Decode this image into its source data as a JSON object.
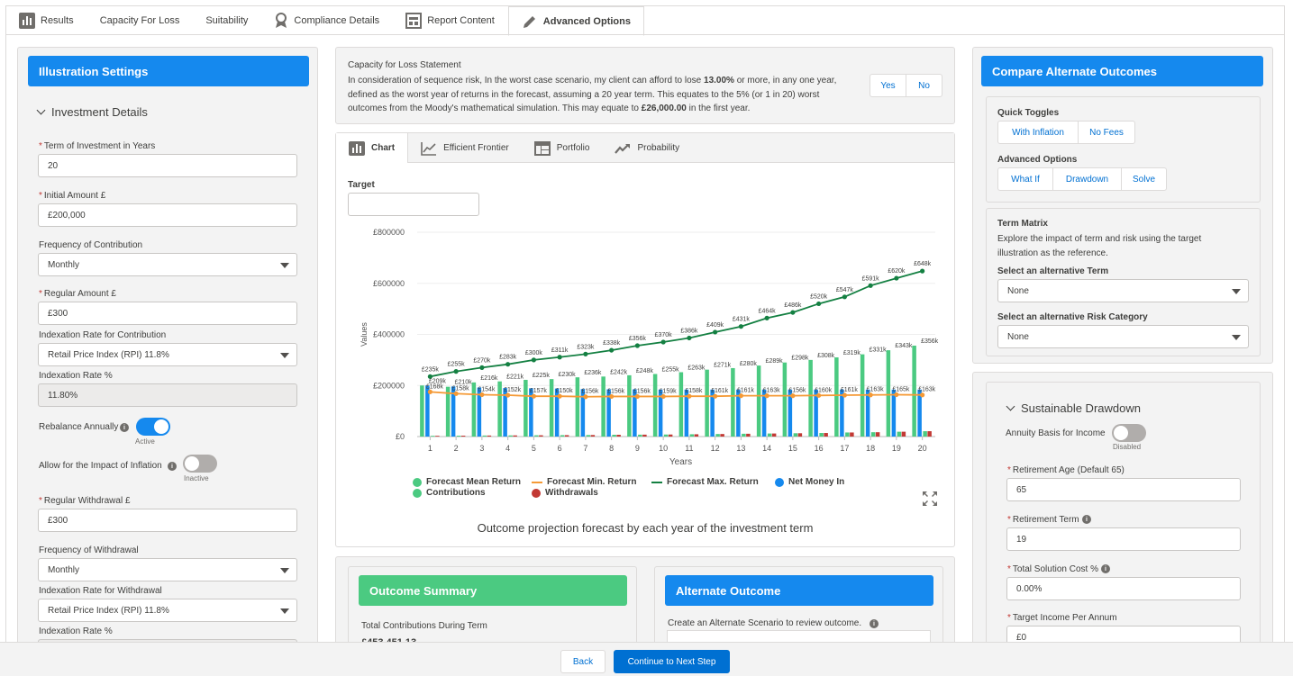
{
  "tabs": [
    {
      "label": "Results",
      "icon": "bar-chart-icon"
    },
    {
      "label": "Capacity For Loss",
      "icon": ""
    },
    {
      "label": "Suitability",
      "icon": ""
    },
    {
      "label": "Compliance Details",
      "icon": "award-icon"
    },
    {
      "label": "Report Content",
      "icon": "report-icon"
    },
    {
      "label": "Advanced Options",
      "icon": "pencil-icon"
    }
  ],
  "left": {
    "header": "Illustration Settings",
    "section": "Investment Details",
    "term_label": "Term of Investment in Years",
    "term_value": "20",
    "initial_label": "Initial Amount £",
    "initial_value": "£200,000",
    "freq_contrib_label": "Frequency of Contribution",
    "freq_contrib_value": "Monthly",
    "regular_label": "Regular Amount £",
    "regular_value": "£300",
    "index_contrib_label": "Indexation Rate for Contribution",
    "index_contrib_value": "Retail Price Index (RPI) 11.8%",
    "index_pct_label": "Indexation Rate %",
    "index_pct_value": "11.80%",
    "rebalance_label": "Rebalance Annually",
    "rebalance_state": "Active",
    "inflation_label": "Allow for the Impact of Inflation",
    "inflation_state": "Inactive",
    "withdraw_label": "Regular Withdrawal £",
    "withdraw_value": "£300",
    "freq_withdraw_label": "Frequency of Withdrawal",
    "freq_withdraw_value": "Monthly",
    "index_withdraw_label": "Indexation Rate for Withdrawal",
    "index_withdraw_value": "Retail Price Index (RPI) 11.8%",
    "index_pct2_label": "Indexation Rate %"
  },
  "cfl": {
    "title": "Capacity for Loss Statement",
    "text_1": "In consideration of sequence risk, In the worst case scenario, my client can afford to lose ",
    "pct": "13.00%",
    "text_2": " or more, in any one year, defined as the worst year of returns in the forecast, assuming a 20 year term. This equates to the 5% (or 1 in 20) worst outcomes from the Moody's mathematical simulation. This may equate to ",
    "amount": "£26,000.00",
    "text_3": " in the first year.",
    "yes": "Yes",
    "no": "No"
  },
  "chart_tabs": [
    {
      "label": "Chart",
      "icon": "bar-chart-icon"
    },
    {
      "label": "Efficient Frontier",
      "icon": "line-chart-icon"
    },
    {
      "label": "Portfolio",
      "icon": "table-icon"
    },
    {
      "label": "Probability",
      "icon": "trend-icon"
    }
  ],
  "target_label": "Target",
  "chart_caption": "Outcome projection forecast by each year of the investment term",
  "chart_data": {
    "type": "bar",
    "xlabel": "Years",
    "ylabel": "Values",
    "y_ticks": [
      "£0",
      "£200000",
      "£400000",
      "£600000",
      "£800000"
    ],
    "ylim": [
      0,
      800000
    ],
    "categories": [
      "1",
      "2",
      "3",
      "4",
      "5",
      "6",
      "7",
      "8",
      "9",
      "10",
      "11",
      "12",
      "13",
      "14",
      "15",
      "16",
      "17",
      "18",
      "19",
      "20"
    ],
    "legend_position": "bottom",
    "series": [
      {
        "name": "Forecast Mean Return",
        "kind": "bar",
        "color": "#4bca81",
        "values": [
          200000,
          195000,
          212000,
          216000,
          222000,
          225000,
          232000,
          235000,
          240000,
          245000,
          252000,
          262000,
          268000,
          278000,
          290000,
          300000,
          310000,
          322000,
          338000,
          356000
        ]
      },
      {
        "name": "Forecast Min. Return",
        "kind": "line",
        "color": "#f59a36",
        "values": [
          175000,
          168000,
          164000,
          162000,
          158000,
          158000,
          156000,
          157000,
          157000,
          157000,
          158000,
          158000,
          160000,
          160000,
          160000,
          161000,
          162000,
          163000,
          164000,
          163000
        ]
      },
      {
        "name": "Forecast Max. Return",
        "kind": "line",
        "color": "#148042",
        "values": [
          235000,
          255000,
          270000,
          283000,
          300000,
          311000,
          323000,
          338000,
          356000,
          370000,
          386000,
          409000,
          431000,
          464000,
          486000,
          520000,
          547000,
          591000,
          620000,
          648000
        ]
      },
      {
        "name": "Net Money In",
        "kind": "bar",
        "color": "#1589ee",
        "values": [
          200000,
          196000,
          192000,
          190000,
          189000,
          188000,
          186000,
          185000,
          185000,
          184000,
          184000,
          184000,
          184000,
          184000,
          184000,
          184000,
          184000,
          184000,
          184000,
          184000
        ]
      },
      {
        "name": "Contributions",
        "kind": "bar",
        "color": "#4bca81",
        "values": [
          3000,
          3500,
          4000,
          4500,
          5000,
          5500,
          6000,
          7000,
          7500,
          8000,
          9000,
          10000,
          11000,
          12000,
          13000,
          14000,
          16000,
          17000,
          19000,
          21000
        ]
      },
      {
        "name": "Withdrawals",
        "kind": "bar",
        "color": "#c23934",
        "values": [
          3000,
          3500,
          4000,
          4500,
          5000,
          5500,
          6000,
          7000,
          7500,
          8000,
          9000,
          10000,
          11000,
          12000,
          13000,
          14000,
          16000,
          17000,
          19000,
          21000
        ]
      }
    ],
    "max_labels": [
      "£235k",
      "£255k",
      "£270k",
      "£283k",
      "£300k",
      "£311k",
      "£323k",
      "£338k",
      "£356k",
      "£370k",
      "£386k",
      "£409k",
      "£431k",
      "£464k",
      "£486k",
      "£520k",
      "£547k",
      "£591k",
      "£620k",
      "£648k"
    ],
    "mean_labels": [
      "£209k",
      "£210k",
      "£216k",
      "£221k",
      "£225k",
      "£230k",
      "£236k",
      "£242k",
      "£248k",
      "£255k",
      "£263k",
      "£271k",
      "£280k",
      "£289k",
      "£298k",
      "£308k",
      "£319k",
      "£331k",
      "£343k",
      "£356k"
    ],
    "min_labels": [
      "£168k",
      "£158k",
      "£154k",
      "£152k",
      "£157k",
      "£150k",
      "£156k",
      "£156k",
      "£156k",
      "£159k",
      "£158k",
      "£161k",
      "£161k",
      "£163k",
      "£156k",
      "£160k",
      "£161k",
      "£163k",
      "£165k",
      "£163k"
    ]
  },
  "summary": {
    "header": "Outcome Summary",
    "label": "Total Contributions During Term",
    "value": "£453,451.13"
  },
  "alternate": {
    "header": "Alternate Outcome",
    "text": "Create an Alternate Scenario to review outcome."
  },
  "right": {
    "header": "Compare Alternate Outcomes",
    "quick_toggles": "Quick Toggles",
    "with_inflation": "With Inflation",
    "no_fees": "No Fees",
    "advanced_options": "Advanced Options",
    "what_if": "What If",
    "drawdown": "Drawdown",
    "solve": "Solve",
    "term_matrix": "Term Matrix",
    "term_matrix_desc": "Explore the impact of term and risk using the target illustration as the reference.",
    "alt_term_label": "Select an alternative Term",
    "alt_term_value": "None",
    "alt_risk_label": "Select an alternative Risk Category",
    "alt_risk_value": "None"
  },
  "drawdown": {
    "section": "Sustainable Drawdown",
    "annuity_label": "Annuity Basis for Income",
    "annuity_state": "Disabled",
    "ret_age_label": "Retirement Age (Default 65)",
    "ret_age_value": "65",
    "ret_term_label": "Retirement Term",
    "ret_term_value": "19",
    "cost_label": "Total Solution Cost %",
    "cost_value": "0.00%",
    "income_label": "Target Income Per Annum",
    "income_value": "£0"
  },
  "footer": {
    "back": "Back",
    "continue": "Continue to Next Step"
  }
}
